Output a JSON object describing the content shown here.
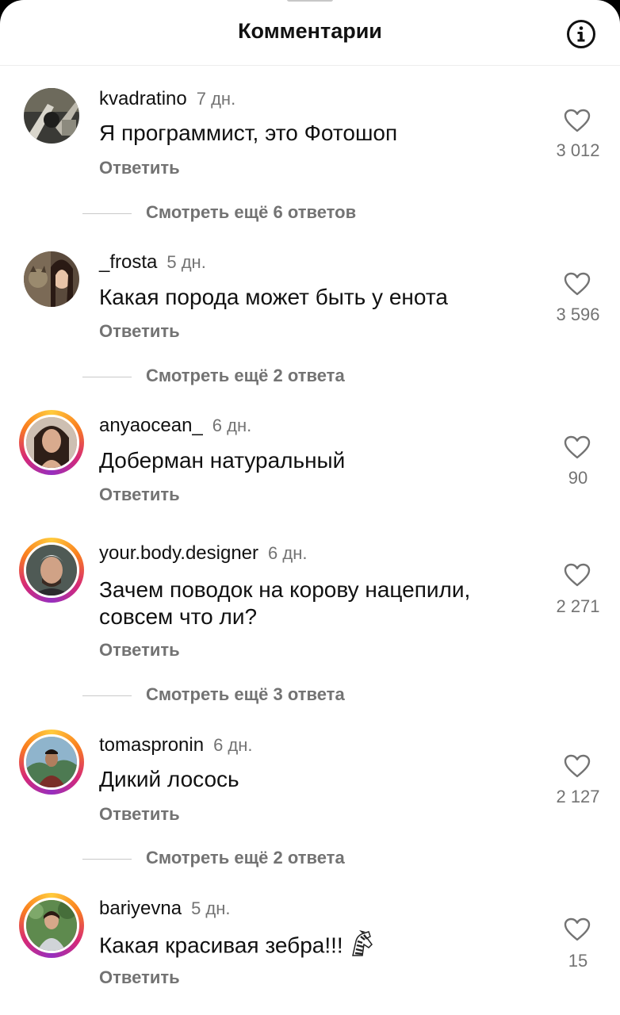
{
  "header": {
    "title": "Комментарии",
    "info_icon": "info-circle-icon"
  },
  "comments": [
    {
      "username": "kvadratino",
      "time": "7 дн.",
      "text": "Я программист, это Фотошоп",
      "reply": "Ответить",
      "likes": "3 012",
      "view_more": "Смотреть ещё 6 ответов"
    },
    {
      "username": "_frosta",
      "time": "5 дн.",
      "text": "Какая порода может быть у енота",
      "reply": "Ответить",
      "likes": "3 596",
      "view_more": "Смотреть ещё 2 ответа"
    },
    {
      "username": "anyaocean_",
      "time": "6 дн.",
      "text": "Доберман натуральный",
      "reply": "Ответить",
      "likes": "90"
    },
    {
      "username": "your.body.designer",
      "time": "6 дн.",
      "text": "Зачем поводок на корову нацепили, совсем что ли?",
      "reply": "Ответить",
      "likes": "2 271",
      "view_more": "Смотреть ещё 3 ответа"
    },
    {
      "username": "tomaspronin",
      "time": "6 дн.",
      "text": "Дикий лосось",
      "reply": "Ответить",
      "likes": "2 127",
      "view_more": "Смотреть ещё 2 ответа"
    },
    {
      "username": "bariyevna",
      "time": "5 дн.",
      "text": "Какая красивая зебра!!!",
      "emoji": "zebra-emoji",
      "reply": "Ответить",
      "likes": "15"
    }
  ],
  "colors": {
    "secondary_text": "#737373",
    "primary_text": "#111111",
    "story_ring": [
      "#ffcb3d",
      "#fa7e1e",
      "#d62976",
      "#962fbf"
    ]
  }
}
